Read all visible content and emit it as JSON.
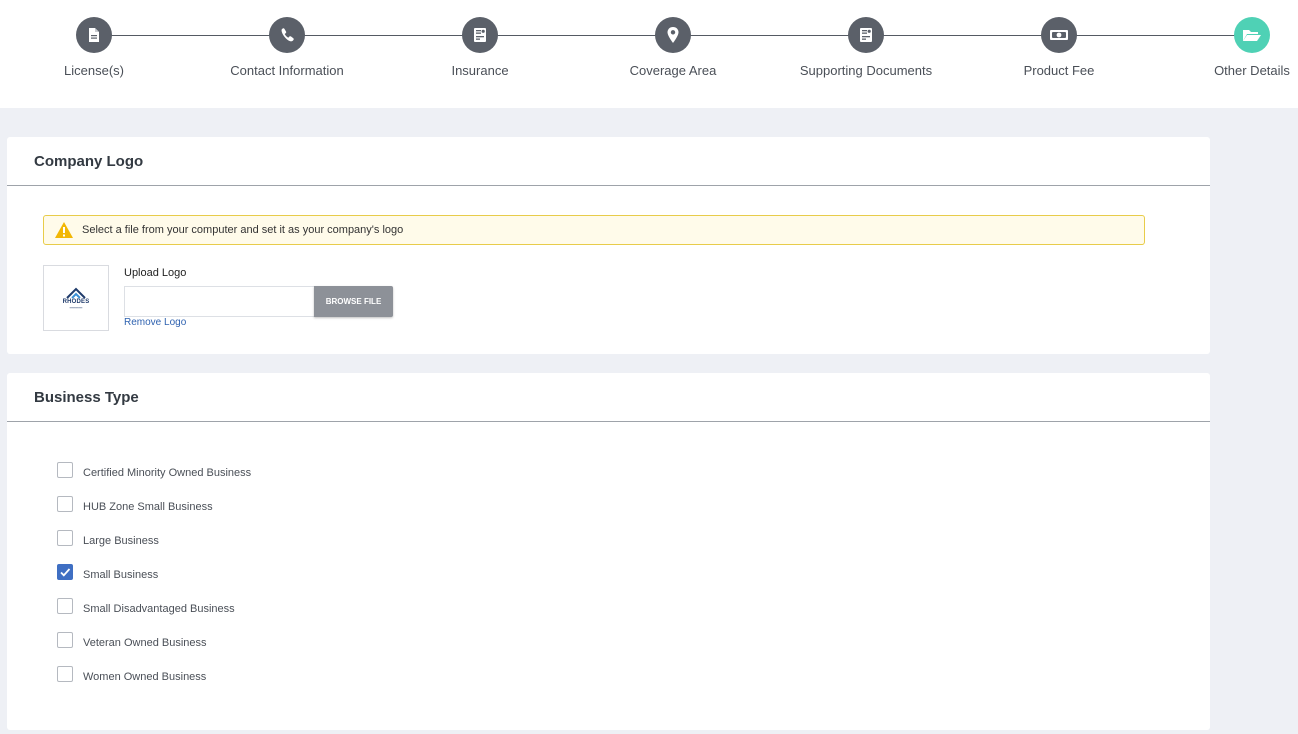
{
  "stepper": {
    "steps": [
      {
        "label": "License(s)",
        "icon": "document-icon",
        "active": false
      },
      {
        "label": "Contact Information",
        "icon": "phone-icon",
        "active": false
      },
      {
        "label": "Insurance",
        "icon": "insurance-card-icon",
        "active": false
      },
      {
        "label": "Coverage Area",
        "icon": "map-pin-icon",
        "active": false
      },
      {
        "label": "Supporting Documents",
        "icon": "documents-icon",
        "active": false
      },
      {
        "label": "Product Fee",
        "icon": "money-icon",
        "active": false
      },
      {
        "label": "Other Details",
        "icon": "folder-open-icon",
        "active": true
      }
    ],
    "colors": {
      "inactive": "#5b6069",
      "active": "#4fd1b5"
    }
  },
  "company_logo": {
    "title": "Company Logo",
    "alert_text": "Select a file from your computer and set it as your company's logo",
    "logo_word": "RHODES",
    "upload_label": "Upload Logo",
    "browse_label": "BROWSE FILE",
    "remove_label": "Remove Logo"
  },
  "business_type": {
    "title": "Business Type",
    "options": [
      {
        "label": "Certified Minority Owned Business",
        "checked": false
      },
      {
        "label": "HUB Zone Small Business",
        "checked": false
      },
      {
        "label": "Large Business",
        "checked": false
      },
      {
        "label": "Small Business",
        "checked": true
      },
      {
        "label": "Small Disadvantaged Business",
        "checked": false
      },
      {
        "label": "Veteran Owned Business",
        "checked": false
      },
      {
        "label": "Women Owned Business",
        "checked": false
      }
    ]
  },
  "colors": {
    "link": "#2f62b0",
    "checkbox_checked": "#3f6fc3",
    "alert_border": "#e8cc4a"
  }
}
